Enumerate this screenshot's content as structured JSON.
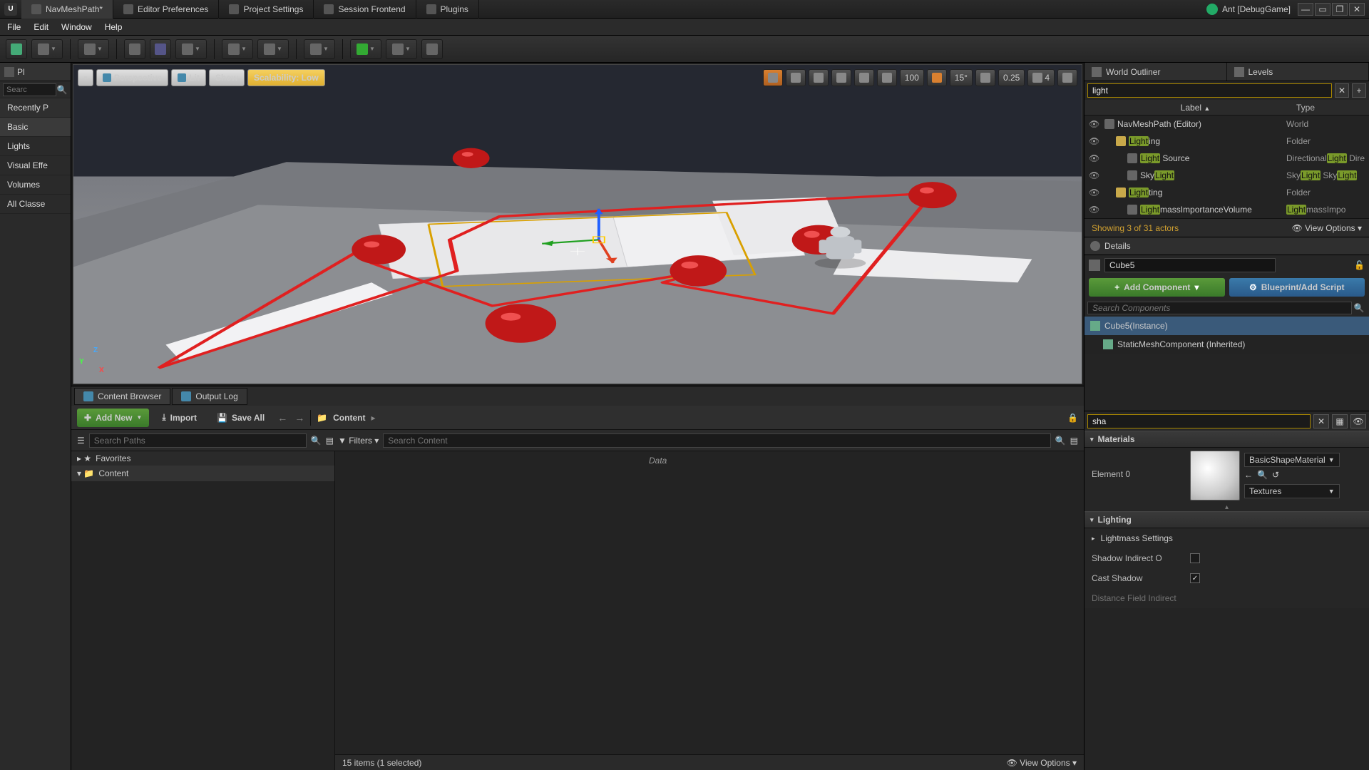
{
  "title": {
    "tabs": [
      {
        "label": "NavMeshPath*",
        "active": true
      },
      {
        "label": "Editor Preferences"
      },
      {
        "label": "Project Settings"
      },
      {
        "label": "Session Frontend"
      },
      {
        "label": "Plugins"
      }
    ],
    "project": "Ant [DebugGame]"
  },
  "menubar": [
    "File",
    "Edit",
    "Window",
    "Help"
  ],
  "placeActors": {
    "title": "Pl",
    "search": "",
    "recent": "Recently P",
    "cats": [
      "Basic",
      "Lights",
      "Visual Effe",
      "Volumes",
      "All Classe"
    ]
  },
  "viewport": {
    "perspective": "Perspective",
    "lit": "Lit",
    "show": "Show",
    "scalability": "Scalability: Low",
    "snap_pos": "100",
    "snap_rot": "15°",
    "snap_scale": "0.25",
    "cam_speed": "4"
  },
  "bottomTabs": [
    {
      "label": "Content Browser",
      "active": true
    },
    {
      "label": "Output Log"
    }
  ],
  "contentBrowser": {
    "addNew": "Add New",
    "import": "Import",
    "saveAll": "Save All",
    "path": "Content",
    "filters": "Filters",
    "searchPaths": "Search Paths",
    "searchContent": "Search Content",
    "favorites": "Favorites",
    "root": "Content",
    "status": "15 items (1 selected)",
    "viewOptions": "View Options",
    "placeholder_item": "Data"
  },
  "worldOutliner": {
    "title": "World Outliner",
    "levels": "Levels",
    "search": "light",
    "colLabel": "Label",
    "colType": "Type",
    "rows": [
      {
        "indent": 0,
        "icon": "world",
        "label_pre": "NavMeshPath (Editor)",
        "hl": "",
        "label_post": "",
        "type": "World"
      },
      {
        "indent": 1,
        "icon": "folder",
        "label_pre": "",
        "hl": "Light",
        "label_post": "ing",
        "type": "Folder"
      },
      {
        "indent": 2,
        "icon": "light",
        "label_pre": "",
        "hl": "Light",
        "label_post": " Source",
        "type_pre": "Directional",
        "type_hl": "Light",
        "type_post": " Directional",
        "type_hl2": "Light"
      },
      {
        "indent": 2,
        "icon": "light",
        "label_pre": "Sky",
        "hl": "Light",
        "label_post": "",
        "type_pre": "Sky",
        "type_hl": "Light",
        "type_post": " Sky",
        "type_hl2": "Light"
      },
      {
        "indent": 1,
        "icon": "folder",
        "label_pre": "",
        "hl": "Light",
        "label_post": "ting",
        "type": "Folder"
      },
      {
        "indent": 2,
        "icon": "vol",
        "label_pre": "",
        "hl": "Light",
        "label_post": "massImportanceVolume",
        "type_pre": "",
        "type_hl": "Light",
        "type_post": "massImpo"
      }
    ],
    "footer": "Showing 3 of 31 actors",
    "viewOptions": "View Options"
  },
  "details": {
    "title": "Details",
    "actorName": "Cube5",
    "addComponent": "Add Component",
    "blueprint": "Blueprint/Add Script",
    "searchComponents": "Search Components",
    "components": [
      {
        "label": "Cube5(Instance)",
        "sel": true
      },
      {
        "label": "StaticMeshComponent (Inherited)"
      }
    ],
    "filter": "sha",
    "sections": {
      "materials": {
        "title": "Materials",
        "element": "Element 0",
        "material": "BasicShapeMaterial",
        "textures": "Textures"
      },
      "lighting": {
        "title": "Lighting",
        "lightmass": "Lightmass Settings",
        "props": [
          {
            "label": "Shadow Indirect O",
            "checked": false
          },
          {
            "label": "Cast Shadow",
            "checked": true
          }
        ],
        "distance": "Distance Field Indirect"
      }
    }
  }
}
